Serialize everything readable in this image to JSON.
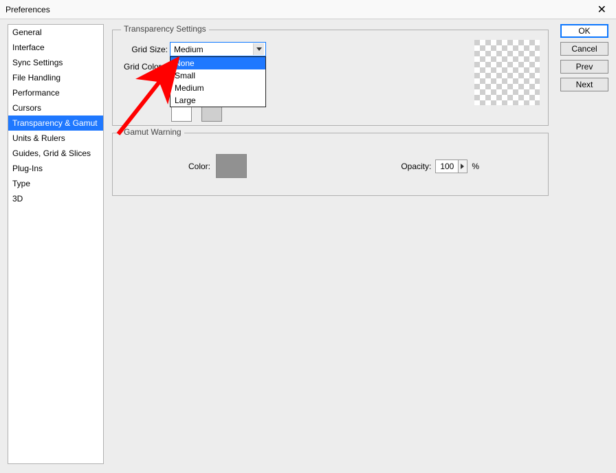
{
  "window": {
    "title": "Preferences"
  },
  "sidebar": {
    "items": [
      {
        "label": "General"
      },
      {
        "label": "Interface"
      },
      {
        "label": "Sync Settings"
      },
      {
        "label": "File Handling"
      },
      {
        "label": "Performance"
      },
      {
        "label": "Cursors"
      },
      {
        "label": "Transparency & Gamut"
      },
      {
        "label": "Units & Rulers"
      },
      {
        "label": "Guides, Grid & Slices"
      },
      {
        "label": "Plug-Ins"
      },
      {
        "label": "Type"
      },
      {
        "label": "3D"
      }
    ],
    "selected_index": 6
  },
  "buttons": {
    "ok": "OK",
    "cancel": "Cancel",
    "prev": "Prev",
    "next": "Next"
  },
  "transparency": {
    "legend": "Transparency Settings",
    "grid_size_label": "Grid Size:",
    "grid_size_value": "Medium",
    "grid_size_options": [
      "None",
      "Small",
      "Medium",
      "Large"
    ],
    "highlighted_option_index": 0,
    "grid_colors_label": "Grid Colors:"
  },
  "gamut": {
    "legend": "Gamut Warning",
    "color_label": "Color:",
    "opacity_label": "Opacity:",
    "opacity_value": "100",
    "opacity_unit": "%"
  }
}
